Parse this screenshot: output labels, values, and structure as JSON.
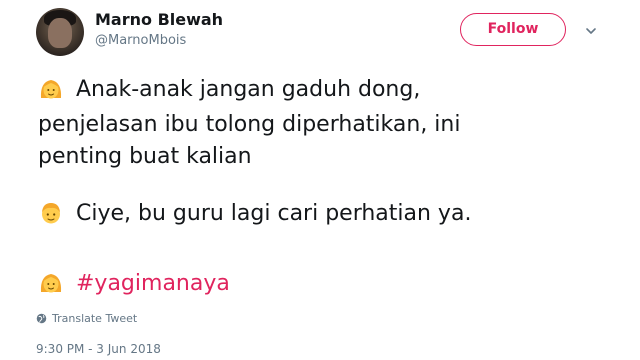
{
  "user": {
    "name": "Marno Blewah",
    "handle": "@MarnoMbois"
  },
  "follow_label": "Follow",
  "tweet": {
    "lines": [
      "Anak-anak jangan gaduh dong,",
      "penjelasan ibu tolong diperhatikan, ini",
      "penting buat kalian",
      "Ciye, bu guru lagi cari perhatian ya.",
      "#yagimanaya"
    ]
  },
  "translate_label": "Translate Tweet",
  "timestamp": "9:30 PM - 3 Jun 2018",
  "colors": {
    "accent": "#e0245e",
    "secondary_text": "#657786"
  },
  "icons": [
    "woman-emoji-icon",
    "boy-emoji-icon",
    "globe-icon",
    "chevron-down-icon"
  ]
}
